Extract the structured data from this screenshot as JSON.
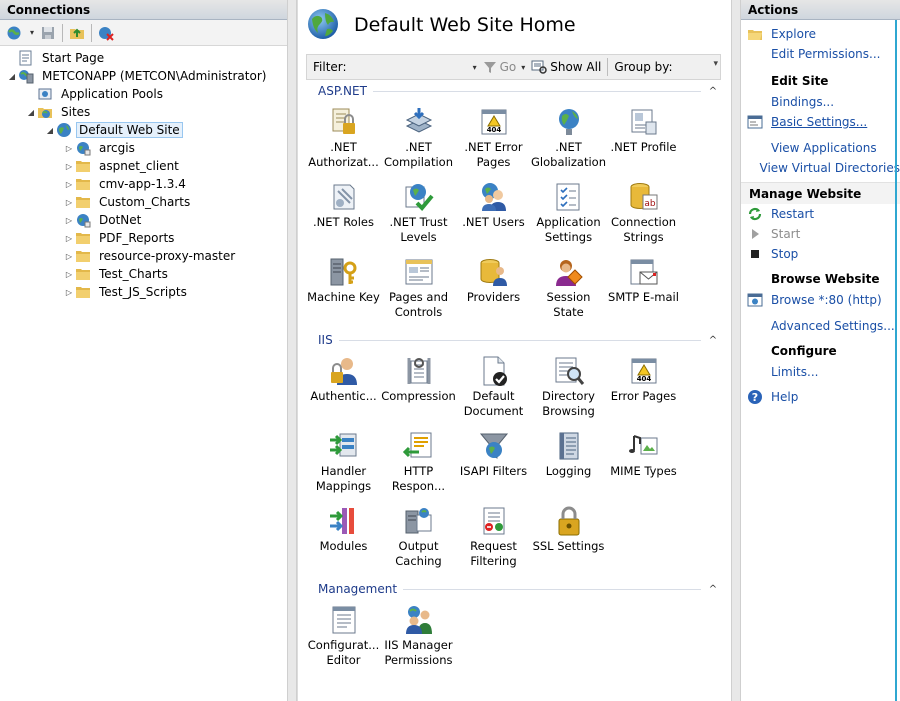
{
  "connections": {
    "title": "Connections",
    "tree": [
      {
        "label": "Start Page",
        "level": 0,
        "icon": "start-page-icon",
        "expander": ""
      },
      {
        "label": "METCONAPP (METCON\\Administrator)",
        "level": 0,
        "icon": "server-icon",
        "expander": "◢"
      },
      {
        "label": "Application Pools",
        "level": 1,
        "icon": "app-pools-icon",
        "expander": ""
      },
      {
        "label": "Sites",
        "level": 1,
        "icon": "sites-icon",
        "expander": "◢"
      },
      {
        "label": "Default Web Site",
        "level": 2,
        "icon": "globe-icon",
        "expander": "◢",
        "selected": true
      },
      {
        "label": "arcgis",
        "level": 3,
        "icon": "app-globe-icon",
        "expander": "▷"
      },
      {
        "label": "aspnet_client",
        "level": 3,
        "icon": "folder-icon",
        "expander": "▷"
      },
      {
        "label": "cmv-app-1.3.4",
        "level": 3,
        "icon": "folder-icon",
        "expander": "▷"
      },
      {
        "label": "Custom_Charts",
        "level": 3,
        "icon": "folder-icon",
        "expander": "▷"
      },
      {
        "label": "DotNet",
        "level": 3,
        "icon": "app-globe-icon",
        "expander": "▷"
      },
      {
        "label": "PDF_Reports",
        "level": 3,
        "icon": "folder-icon",
        "expander": "▷"
      },
      {
        "label": "resource-proxy-master",
        "level": 3,
        "icon": "folder-icon",
        "expander": "▷"
      },
      {
        "label": "Test_Charts",
        "level": 3,
        "icon": "folder-icon",
        "expander": "▷"
      },
      {
        "label": "Test_JS_Scripts",
        "level": 3,
        "icon": "folder-icon",
        "expander": "▷"
      }
    ]
  },
  "center": {
    "title": "Default Web Site Home",
    "filter_label": "Filter:",
    "go_label": "Go",
    "show_all_label": "Show All",
    "group_by_label": "Group by:",
    "sections": [
      {
        "name": "ASP.NET",
        "features": [
          {
            "label": ".NET\nAuthorizat...",
            "icon": "net-authorization-icon"
          },
          {
            "label": ".NET\nCompilation",
            "icon": "net-compilation-icon"
          },
          {
            "label": ".NET Error\nPages",
            "icon": "net-error-pages-icon"
          },
          {
            "label": ".NET\nGlobalization",
            "icon": "net-globalization-icon"
          },
          {
            "label": ".NET Profile",
            "icon": "net-profile-icon"
          },
          {
            "label": ".NET Roles",
            "icon": "net-roles-icon"
          },
          {
            "label": ".NET Trust\nLevels",
            "icon": "net-trust-levels-icon"
          },
          {
            "label": ".NET Users",
            "icon": "net-users-icon"
          },
          {
            "label": "Application\nSettings",
            "icon": "application-settings-icon"
          },
          {
            "label": "Connection\nStrings",
            "icon": "connection-strings-icon"
          },
          {
            "label": "Machine Key",
            "icon": "machine-key-icon"
          },
          {
            "label": "Pages and\nControls",
            "icon": "pages-controls-icon"
          },
          {
            "label": "Providers",
            "icon": "providers-icon"
          },
          {
            "label": "Session State",
            "icon": "session-state-icon"
          },
          {
            "label": "SMTP E-mail",
            "icon": "smtp-email-icon"
          }
        ]
      },
      {
        "name": "IIS",
        "features": [
          {
            "label": "Authentic...",
            "icon": "authentication-icon"
          },
          {
            "label": "Compression",
            "icon": "compression-icon"
          },
          {
            "label": "Default\nDocument",
            "icon": "default-document-icon"
          },
          {
            "label": "Directory\nBrowsing",
            "icon": "directory-browsing-icon"
          },
          {
            "label": "Error Pages",
            "icon": "error-pages-icon"
          },
          {
            "label": "Handler\nMappings",
            "icon": "handler-mappings-icon"
          },
          {
            "label": "HTTP\nRespon...",
            "icon": "http-response-icon"
          },
          {
            "label": "ISAPI Filters",
            "icon": "isapi-filters-icon"
          },
          {
            "label": "Logging",
            "icon": "logging-icon"
          },
          {
            "label": "MIME Types",
            "icon": "mime-types-icon"
          },
          {
            "label": "Modules",
            "icon": "modules-icon"
          },
          {
            "label": "Output\nCaching",
            "icon": "output-caching-icon"
          },
          {
            "label": "Request\nFiltering",
            "icon": "request-filtering-icon"
          },
          {
            "label": "SSL Settings",
            "icon": "ssl-settings-icon"
          }
        ]
      },
      {
        "name": "Management",
        "features": [
          {
            "label": "Configurat...\nEditor",
            "icon": "configuration-editor-icon"
          },
          {
            "label": "IIS Manager\nPermissions",
            "icon": "iis-manager-permissions-icon"
          }
        ]
      }
    ]
  },
  "actions": {
    "title": "Actions",
    "explore": "Explore",
    "edit_permissions": "Edit Permissions...",
    "edit_site_header": "Edit Site",
    "bindings": "Bindings...",
    "basic_settings": "Basic Settings...",
    "view_applications": "View Applications",
    "view_virtual_directories": "View Virtual Directories",
    "manage_website_header": "Manage Website",
    "restart": "Restart",
    "start": "Start",
    "stop": "Stop",
    "browse_website_header": "Browse Website",
    "browse_80": "Browse *:80 (http)",
    "advanced_settings": "Advanced Settings...",
    "configure_header": "Configure",
    "limits": "Limits...",
    "help": "Help"
  },
  "colors": {
    "link": "#1a4fa6",
    "section_title": "#1e3b8a",
    "accent_edge": "#2fa7d1"
  }
}
